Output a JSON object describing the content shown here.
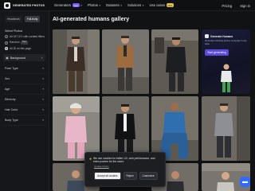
{
  "brand": {
    "logo_text": "GENERATED PHOTOS"
  },
  "nav": {
    "items": [
      {
        "label": "Generators",
        "badge": "New"
      },
      {
        "label": "Photos"
      },
      {
        "label": "Datasets"
      },
      {
        "label": "Solutions"
      },
      {
        "label": "Use cases",
        "badge": "New"
      }
    ],
    "pricing": "Pricing",
    "signin": "Sign in"
  },
  "sidebar": {
    "tabs": [
      {
        "label": "Headshots"
      },
      {
        "label": "Full-body"
      }
    ],
    "section_title": "Select Photos",
    "options": [
      {
        "label": "All 167,371 with curated filters"
      },
      {
        "label": "Random",
        "tag": "New"
      },
      {
        "label": "All 20 on this page"
      }
    ],
    "background_label": "Background",
    "filters": [
      "Pose Type",
      "Sex",
      "Age",
      "Ethnicity",
      "Hair Color",
      "Body Type"
    ]
  },
  "main": {
    "title": "AI-generated humans gallery"
  },
  "promo": {
    "title": "Generate Humans",
    "text": "Generate full-body photos of people in any style",
    "button": "Start generating"
  },
  "cookie": {
    "text": "We use cookies for better UX, web performance, and extra powers for the users",
    "policy_link": "Cookie Policy",
    "accept": "Accept all cookies",
    "reject": "Reject",
    "customize": "Customize"
  },
  "colors": {
    "accent": "#5b4bd8",
    "chat": "#2f6bff",
    "background": "#111214"
  }
}
